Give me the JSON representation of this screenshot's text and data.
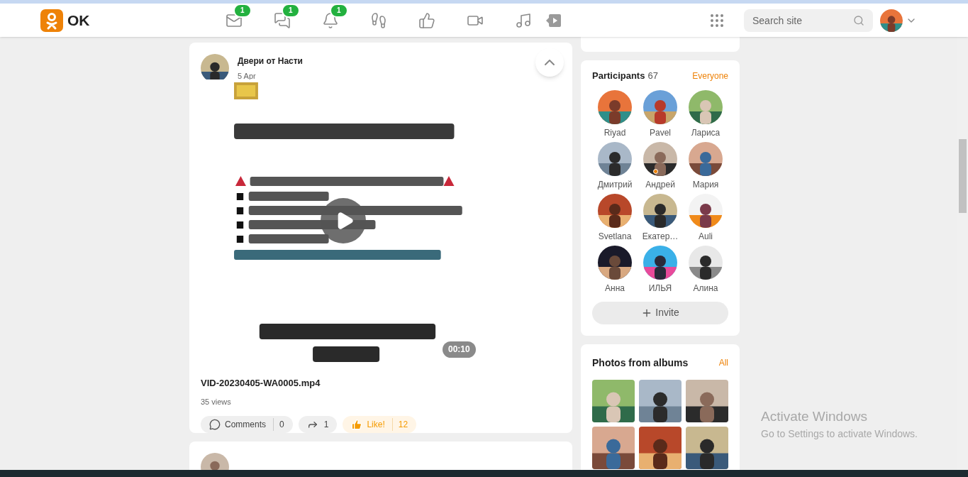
{
  "header": {
    "logo_text": "OK",
    "nav": [
      {
        "kind": "mail",
        "badge": "1"
      },
      {
        "kind": "chat",
        "badge": "1"
      },
      {
        "kind": "bell",
        "badge": "1"
      },
      {
        "kind": "footprints"
      },
      {
        "kind": "like"
      },
      {
        "kind": "video"
      },
      {
        "kind": "music"
      },
      {
        "kind": "play"
      }
    ],
    "search": {
      "placeholder": "Search site"
    }
  },
  "post": {
    "author": "Двери от Насти",
    "date": "5 Apr",
    "video": {
      "kind": "picture",
      "duration": "00:10"
    },
    "title": "VID-20230405-WA0005.mp4",
    "views": "35 views",
    "actions": {
      "comments": {
        "label": "Comments",
        "count": "0"
      },
      "share": {
        "count": "1"
      },
      "like": {
        "label": "Like!",
        "count": "12"
      }
    }
  },
  "participants": {
    "title": "Participants",
    "count": "67",
    "link": "Everyone",
    "members": [
      {
        "name": "Riyad",
        "online": false
      },
      {
        "name": "Pavel",
        "online": false
      },
      {
        "name": "Лариса",
        "online": false
      },
      {
        "name": "Дмитрий",
        "online": false
      },
      {
        "name": "Андрей",
        "online": true
      },
      {
        "name": "Мария",
        "online": false
      },
      {
        "name": "Svetlana",
        "online": false
      },
      {
        "name": "Екатер…",
        "online": false
      },
      {
        "name": "Auli",
        "online": false
      },
      {
        "name": "Анна",
        "online": false
      },
      {
        "name": "ИЛЬЯ",
        "online": false
      },
      {
        "name": "Алина",
        "online": false
      }
    ],
    "invite": "Invite"
  },
  "photos": {
    "title": "Photos from albums",
    "link": "All"
  },
  "windows_notice": {
    "title": "Activate Windows",
    "subtitle": "Go to Settings to activate Windows."
  }
}
